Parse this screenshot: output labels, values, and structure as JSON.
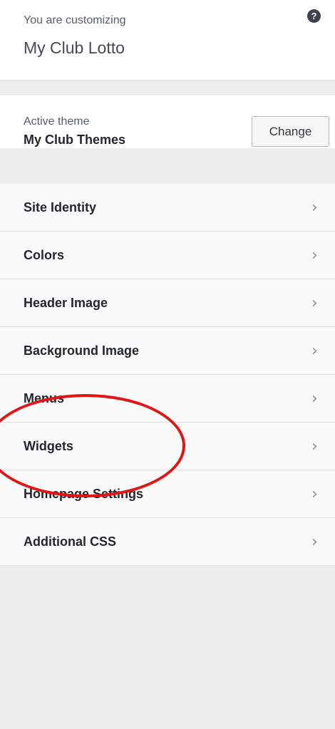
{
  "header": {
    "subtitle": "You are customizing",
    "title": "My Club Lotto",
    "help_icon": "question-circle-icon"
  },
  "theme": {
    "label": "Active theme",
    "name": "My Club Themes",
    "change_label": "Change"
  },
  "menu": {
    "items": [
      {
        "label": "Site Identity"
      },
      {
        "label": "Colors"
      },
      {
        "label": "Header Image"
      },
      {
        "label": "Background Image"
      },
      {
        "label": "Menus"
      },
      {
        "label": "Widgets"
      },
      {
        "label": "Homepage Settings"
      },
      {
        "label": "Additional CSS"
      }
    ],
    "chevron": "›"
  },
  "colors": {
    "annotation": "#e01515",
    "background": "#eeeeee"
  }
}
